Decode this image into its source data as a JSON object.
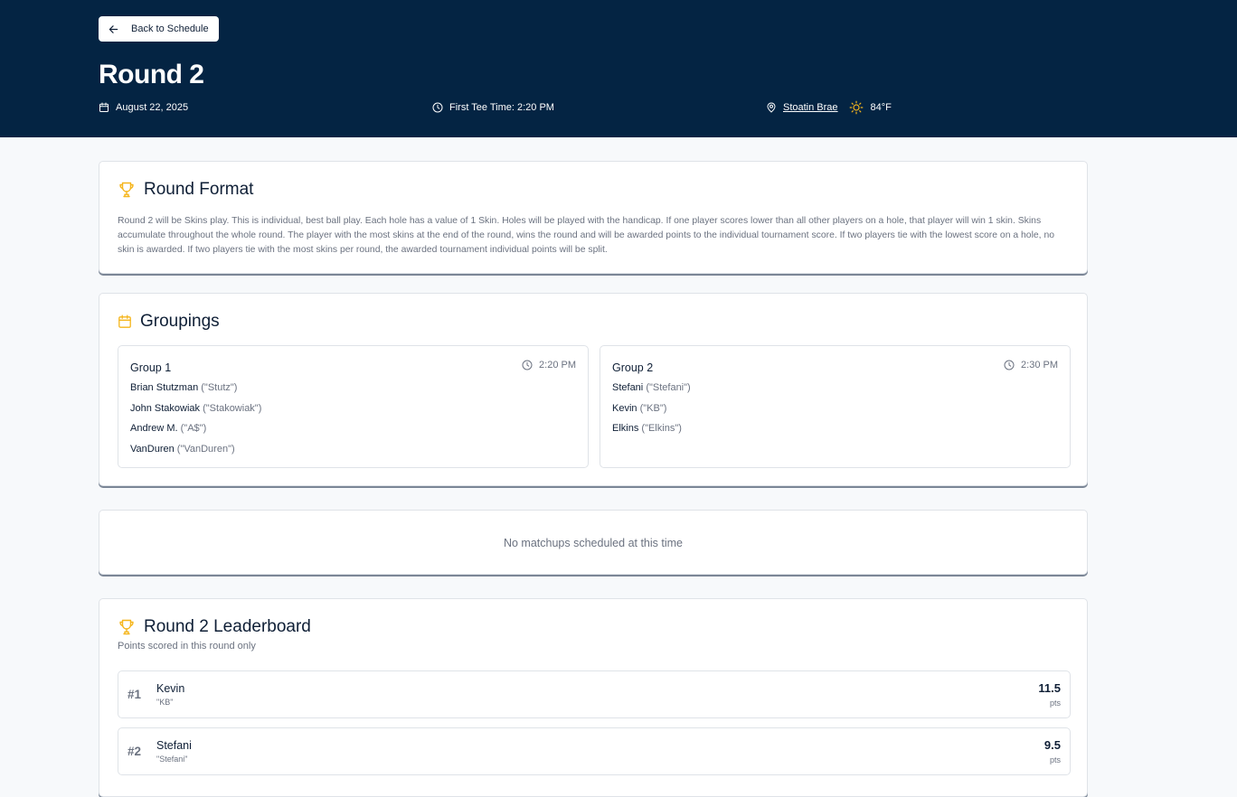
{
  "header": {
    "back_label": "Back to Schedule",
    "title": "Round 2",
    "date": "August 22, 2025",
    "tee_time": "First Tee Time: 2:20 PM",
    "course": "Stoatin Brae",
    "temperature": "84°F"
  },
  "colors": {
    "header_bg": "#042443",
    "accent": "#f5b51b",
    "muted": "#6b7280"
  },
  "format": {
    "title": "Round Format",
    "description": "Round 2 will be Skins play. This is individual, best ball play. Each hole has a value of 1 Skin. Holes will be played with the handicap. If one player scores lower than all other players on a hole, that player will win 1 skin. Skins accumulate throughout the whole round. The player with the most skins at the end of the round, wins the round and will be awarded points to the individual tournament score. If two players tie with the lowest score on a hole, no skin is awarded. If two players tie with the most skins per round, the awarded tournament individual points will be split."
  },
  "groupings": {
    "title": "Groupings",
    "groups": [
      {
        "name": "Group 1",
        "time": "2:20 PM",
        "players": [
          {
            "name": "Brian Stutzman",
            "nickname": "(\"Stutz\")"
          },
          {
            "name": "John Stakowiak",
            "nickname": "(\"Stakowiak\")"
          },
          {
            "name": "Andrew M.",
            "nickname": "(\"A$\")"
          },
          {
            "name": "VanDuren",
            "nickname": "(\"VanDuren\")"
          }
        ]
      },
      {
        "name": "Group 2",
        "time": "2:30 PM",
        "players": [
          {
            "name": "Stefani",
            "nickname": "(\"Stefani\")"
          },
          {
            "name": "Kevin",
            "nickname": "(\"KB\")"
          },
          {
            "name": "Elkins",
            "nickname": "(\"Elkins\")"
          }
        ]
      }
    ]
  },
  "matchups": {
    "empty_text": "No matchups scheduled at this time"
  },
  "leaderboard": {
    "title": "Round 2 Leaderboard",
    "subtitle": "Points scored in this round only",
    "rows": [
      {
        "rank": "#1",
        "name": "Kevin",
        "nickname": "\"KB\"",
        "points": "11.5",
        "unit": "pts"
      },
      {
        "rank": "#2",
        "name": "Stefani",
        "nickname": "\"Stefani\"",
        "points": "9.5",
        "unit": "pts"
      }
    ]
  },
  "icons": {
    "back": "arrow-left-icon",
    "date": "calendar-icon",
    "tee": "clock-icon",
    "location": "map-pin-icon",
    "weather": "sun-icon",
    "format": "trophy-icon",
    "groupings": "calendar-icon",
    "leaderboard": "trophy-icon"
  }
}
